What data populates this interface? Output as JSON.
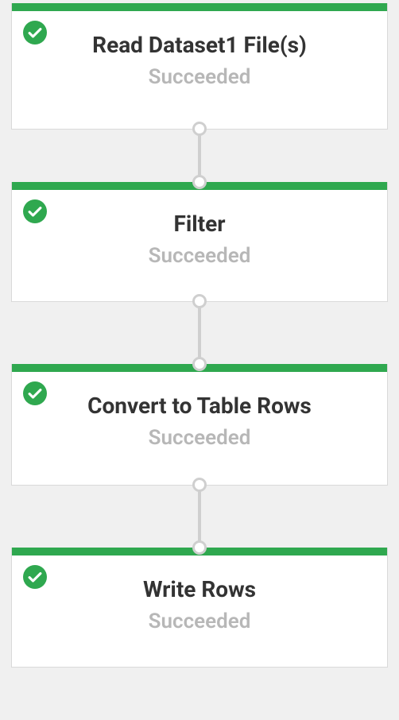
{
  "colors": {
    "success": "#2fa84f",
    "status_text": "#b7b7b7",
    "title_text": "#333333",
    "port_border": "#cfcfcf",
    "bg": "#f0f0f0"
  },
  "pipeline": {
    "nodes": [
      {
        "title": "Read Dataset1 File(s)",
        "status": "Succeeded",
        "icon": "check-circle-icon"
      },
      {
        "title": "Filter",
        "status": "Succeeded",
        "icon": "check-circle-icon"
      },
      {
        "title": "Convert to Table Rows",
        "status": "Succeeded",
        "icon": "check-circle-icon"
      },
      {
        "title": "Write Rows",
        "status": "Succeeded",
        "icon": "check-circle-icon"
      }
    ]
  }
}
